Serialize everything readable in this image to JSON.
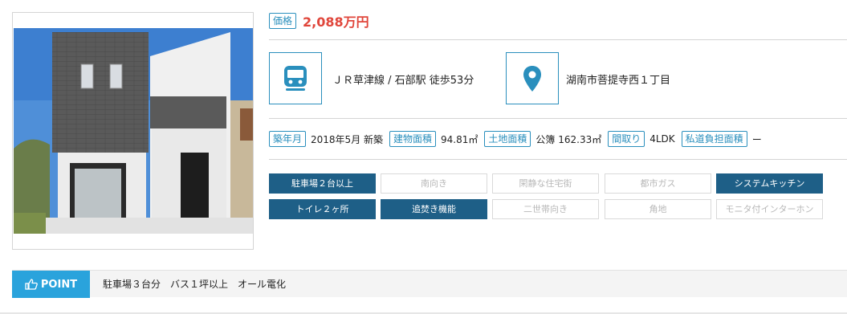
{
  "price": {
    "label": "価格",
    "value": "2,088万円"
  },
  "access": {
    "train_icon": "train-icon",
    "station": "ＪＲ草津線 / 石部駅 徒歩53分",
    "location_icon": "location-pin-icon",
    "address": "湖南市菩提寺西１丁目"
  },
  "specs": [
    {
      "label": "築年月",
      "value": "2018年5月 新築"
    },
    {
      "label": "建物面積",
      "value": "94.81㎡"
    },
    {
      "label": "土地面積",
      "value": "公簿 162.33㎡"
    },
    {
      "label": "間取り",
      "value": "4LDK"
    },
    {
      "label": "私道負担面積",
      "value": "ー"
    }
  ],
  "features": [
    {
      "label": "駐車場２台以上",
      "active": true
    },
    {
      "label": "南向き",
      "active": false
    },
    {
      "label": "閑静な住宅街",
      "active": false
    },
    {
      "label": "都市ガス",
      "active": false
    },
    {
      "label": "システムキッチン",
      "active": true
    },
    {
      "label": "トイレ２ヶ所",
      "active": true
    },
    {
      "label": "追焚き機能",
      "active": true
    },
    {
      "label": "二世帯向き",
      "active": false
    },
    {
      "label": "角地",
      "active": false
    },
    {
      "label": "モニタ付インターホン",
      "active": false
    }
  ],
  "point": {
    "icon": "thumbs-up-icon",
    "label": "POINT",
    "text": "駐車場３台分　バス１坪以上　オール電化"
  },
  "colors": {
    "accent": "#2a8fbd",
    "feature_on": "#1e5f87",
    "price": "#e0463b",
    "point": "#2aa3dc"
  }
}
